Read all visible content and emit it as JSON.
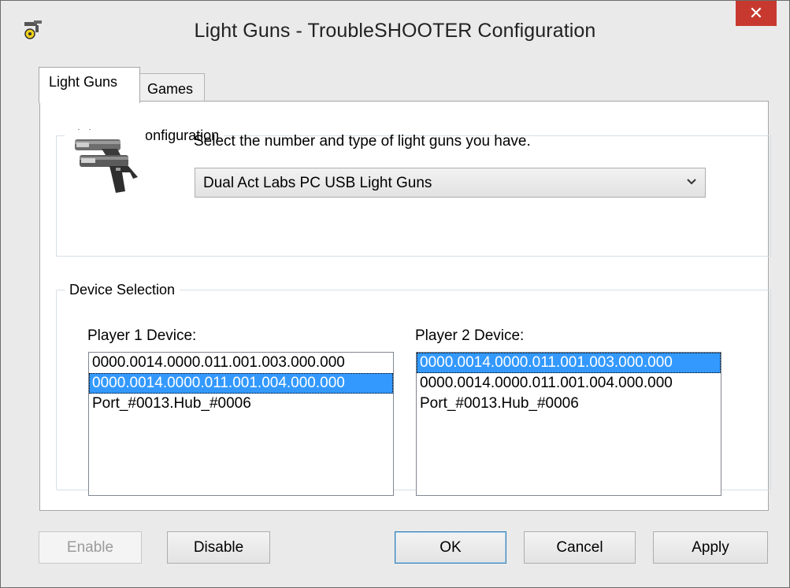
{
  "window": {
    "title": "Light Guns - TroubleSHOOTER Configuration",
    "close_glyph": "✕",
    "app_icon": "gun-target-icon"
  },
  "tabs": [
    {
      "label": "Light Guns",
      "selected": true
    },
    {
      "label": "Games",
      "selected": false
    }
  ],
  "gun_config": {
    "legend": "Light Gun Configuration",
    "instruction": "Select the number and type of light guns you have.",
    "selected_type": "Dual Act Labs PC USB Light Guns",
    "image": "dual-light-guns-image"
  },
  "device_selection": {
    "legend": "Device Selection",
    "player1": {
      "label": "Player 1 Device:",
      "items": [
        "0000.0014.0000.011.001.003.000.000",
        "0000.0014.0000.011.001.004.000.000",
        "Port_#0013.Hub_#0006"
      ],
      "selected_index": 1
    },
    "player2": {
      "label": "Player 2 Device:",
      "items": [
        "0000.0014.0000.011.001.003.000.000",
        "0000.0014.0000.011.001.004.000.000",
        "Port_#0013.Hub_#0006"
      ],
      "selected_index": 0
    }
  },
  "buttons": {
    "enable": "Enable",
    "disable": "Disable",
    "ok": "OK",
    "cancel": "Cancel",
    "apply": "Apply"
  },
  "colors": {
    "selection": "#3399ff",
    "close_button": "#c7392f"
  }
}
